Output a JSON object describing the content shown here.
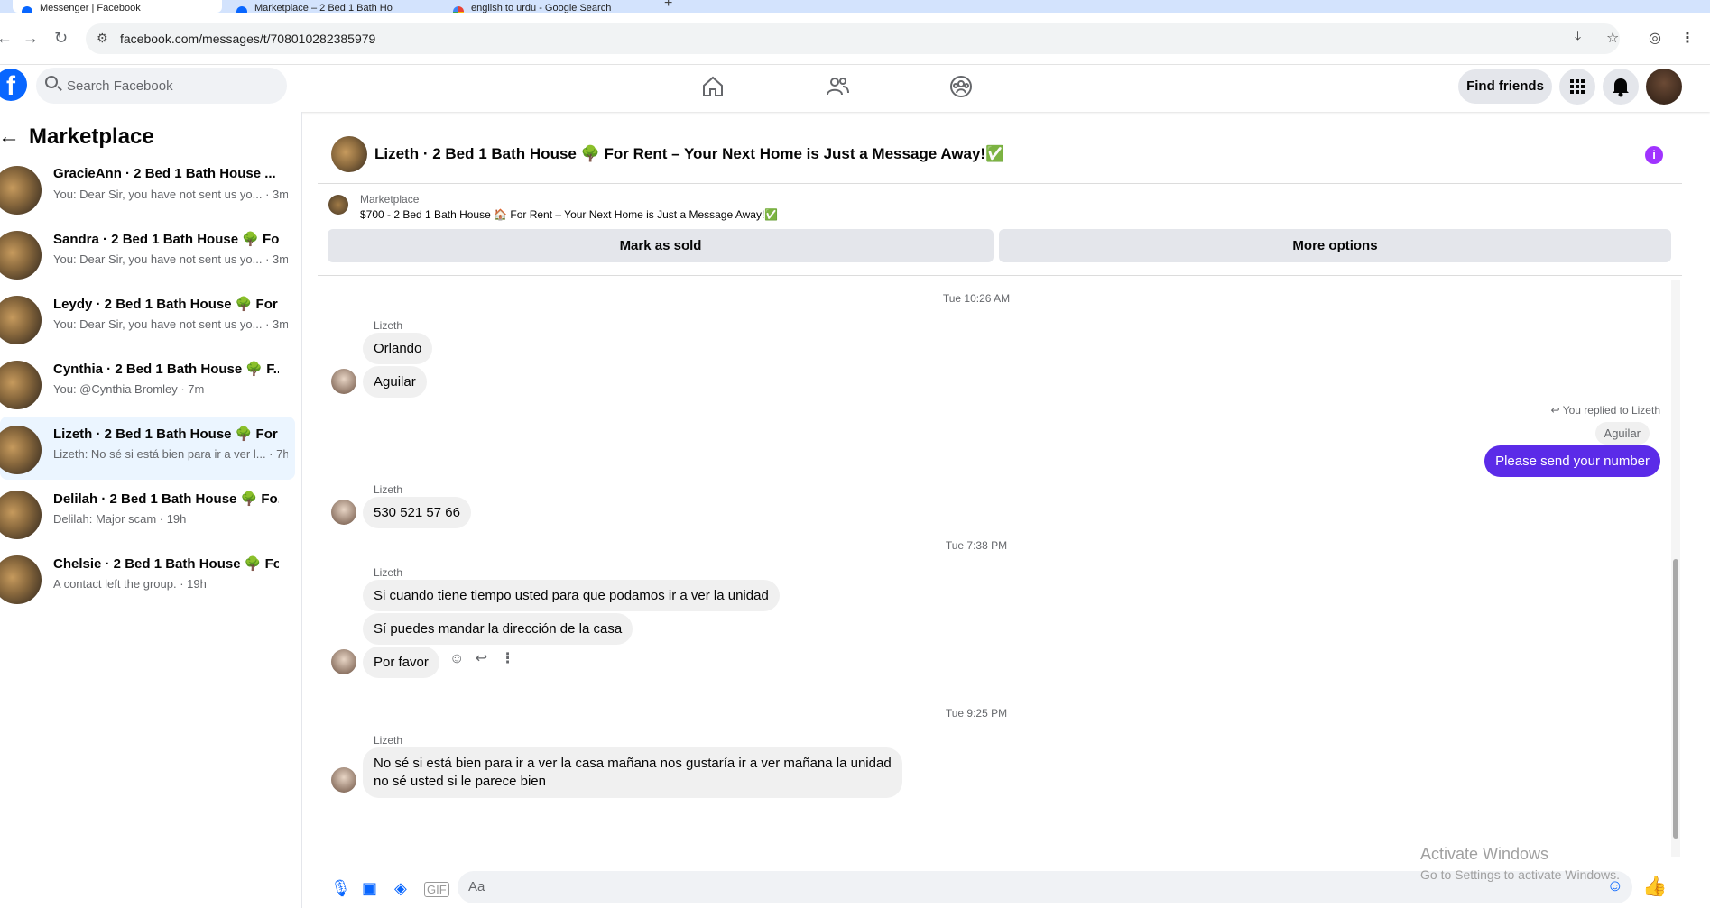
{
  "browser": {
    "tabs": [
      {
        "title": "Messenger | Facebook",
        "active": true
      },
      {
        "title": "Marketplace – 2 Bed 1 Bath Ho",
        "active": false
      },
      {
        "title": "english to urdu - Google Search",
        "active": false
      }
    ],
    "url": "facebook.com/messages/t/708010282385979"
  },
  "fb": {
    "search_placeholder": "Search Facebook",
    "find_friends": "Find friends"
  },
  "sidebar": {
    "title": "Marketplace",
    "conversations": [
      {
        "name": "GracieAnn · 2 Bed 1 Bath House ...",
        "preview": "You: Dear Sir, you have not sent us yo... · 3m",
        "selected": false
      },
      {
        "name": "Sandra · 2 Bed 1 Bath House 🌳 Fo...",
        "preview": "You: Dear Sir, you have not sent us yo... · 3m",
        "selected": false
      },
      {
        "name": "Leydy · 2 Bed 1 Bath House 🌳 For ...",
        "preview": "You: Dear Sir, you have not sent us yo... · 3m",
        "selected": false
      },
      {
        "name": "Cynthia · 2 Bed 1 Bath House 🌳 F...",
        "preview": "You: @Cynthia Bromley · 7m",
        "selected": false
      },
      {
        "name": "Lizeth · 2 Bed 1 Bath House 🌳 For ...",
        "preview": "Lizeth: No sé si está bien para ir a ver l... · 7h",
        "selected": true
      },
      {
        "name": "Delilah · 2 Bed 1 Bath House 🌳 Fo...",
        "preview": "Delilah: Major scam · 19h",
        "selected": false
      },
      {
        "name": "Chelsie · 2 Bed 1 Bath House 🌳 Fo...",
        "preview": "A contact left the group. · 19h",
        "selected": false
      }
    ]
  },
  "chat": {
    "title": "Lizeth · 2 Bed 1 Bath House 🌳 For Rent – Your Next Home is Just a Message Away!✅",
    "marketplace_label": "Marketplace",
    "listing": "$700 - 2 Bed 1 Bath House 🏠 For Rent – Your Next Home is Just a Message Away!✅",
    "mark_sold": "Mark as sold",
    "more_options": "More options",
    "input_placeholder": "Aa",
    "timestamps": [
      "Tue 10:26 AM",
      "Tue 7:38 PM",
      "Tue 9:25 PM"
    ],
    "sender_name": "Lizeth",
    "messages": {
      "m1": "Orlando",
      "m2": "Aguilar",
      "reply_note": "You replied to Lizeth",
      "reply_quote": "Aguilar",
      "me1": "Please send your number",
      "m3": "530 521 57 66",
      "m4": "Si cuando tiene tiempo usted para que podamos ir a ver la unidad",
      "m5": "Sí puedes mandar la dirección de la casa",
      "m6": "Por favor",
      "m7a": "No sé si está bien para ir a ver la casa mañana nos gustaría ir a ver mañana la unidad",
      "m7b": "no sé usted si le parece bien"
    }
  },
  "watermark": {
    "line1": "Activate Windows",
    "line2": "Go to Settings to activate Windows."
  },
  "colors": {
    "fb_blue": "#0866ff",
    "my_bubble": "#5b2be8",
    "selected_row": "#ebf5ff"
  }
}
